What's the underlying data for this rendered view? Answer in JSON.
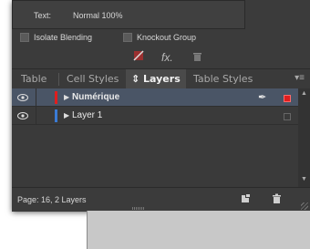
{
  "effects": {
    "text_label": "Text:",
    "text_value": "Normal 100%",
    "isolate_label": "Isolate Blending",
    "knockout_label": "Knockout Group"
  },
  "tabs": [
    {
      "label": "Table"
    },
    {
      "label": "Cell Styles"
    },
    {
      "label": "⇕ Layers"
    },
    {
      "label": "Table Styles"
    }
  ],
  "layers": [
    {
      "name": "Numérique",
      "color": "#e01e1e",
      "selected": true
    },
    {
      "name": "Layer 1",
      "color": "#3a7bd5",
      "selected": false
    }
  ],
  "footer": {
    "status": "Page: 16, 2 Layers"
  },
  "icons": {
    "menu": "panel-menu-icon",
    "pen": "pen-icon",
    "fx": "fx-icon",
    "trash": "trash-icon",
    "new_layer": "new-layer-icon"
  }
}
